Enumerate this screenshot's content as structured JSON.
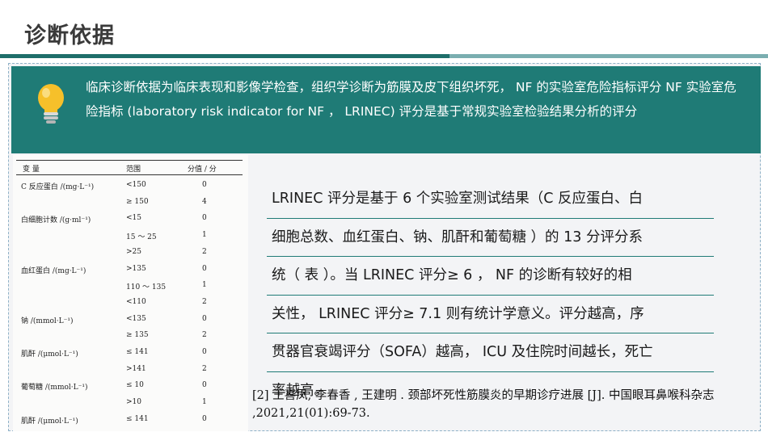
{
  "slide": {
    "title": "诊断依据",
    "banner": {
      "icon": "lightbulb-icon",
      "text": "临床诊断依据为临床表现和影像学检查，组织学诊断为筋膜及皮下组织坏死， NF 的实验室危险指标评分 NF 实验室危险指标 (laboratory risk indicator for NF ， LRINEC) 评分是基于常规实验室检验结果分析的评分"
    },
    "table": {
      "headers": [
        "变 量",
        "范围",
        "分值 / 分"
      ],
      "rows": [
        {
          "variable": "C 反应蛋白 /(mg·L⁻¹)",
          "range": "<150",
          "score": "0"
        },
        {
          "variable": "",
          "range": "≥ 150",
          "score": "4"
        },
        {
          "variable": "白细胞计数 /(g·ml⁻¹)",
          "range": "<15",
          "score": "0"
        },
        {
          "variable": "",
          "range": "15 ～ 25",
          "score": "1"
        },
        {
          "variable": "",
          "range": ">25",
          "score": "2"
        },
        {
          "variable": "血红蛋白 /(mg·L⁻¹)",
          "range": ">135",
          "score": "0"
        },
        {
          "variable": "",
          "range": "110 ～ 135",
          "score": "1"
        },
        {
          "variable": "",
          "range": "<110",
          "score": "2"
        },
        {
          "variable": "钠 /(mmol·L⁻¹)",
          "range": "<135",
          "score": "0"
        },
        {
          "variable": "",
          "range": "≥ 135",
          "score": "2"
        },
        {
          "variable": "肌酐 /(μmol·L⁻¹)",
          "range": "≤ 141",
          "score": "0"
        },
        {
          "variable": "",
          "range": ">141",
          "score": "2"
        },
        {
          "variable": "葡萄糖 /(mmol·L⁻¹)",
          "range": "≤ 10",
          "score": "0"
        },
        {
          "variable": "",
          "range": ">10",
          "score": "1"
        },
        {
          "variable": "肌酐 /(μmol·L⁻¹)",
          "range": "≤ 141",
          "score": "0"
        }
      ]
    },
    "description_lines": [
      "LRINEC 评分是基于 6 个实验室测试结果（C 反应蛋白、白",
      "细胞总数、血红蛋白、钠、肌酐和葡萄糖 ）的 13 分评分系",
      "统（ 表 ）。当 LRINEC 评分≥ 6 ， NF 的诊断有较好的相",
      "关性， LRINEC 评分≥ 7.1 则有统计学意义。评分越高，序",
      "贯器官衰竭评分（SOFA）越高， ICU 及住院时间越长，死亡",
      "率越高。"
    ],
    "reference": "[2] 王喜凤, 李春香 , 王建明 . 颈部坏死性筋膜炎的早期诊疗进展 [J]. 中国眼耳鼻喉科杂志 ,2021,21(01):69-73.",
    "colors": {
      "banner": "#1f7b76",
      "header_bar_dark": "#1e6e6a",
      "header_bar_light": "#7aaeb0",
      "bulb": "#f6c02a"
    }
  }
}
